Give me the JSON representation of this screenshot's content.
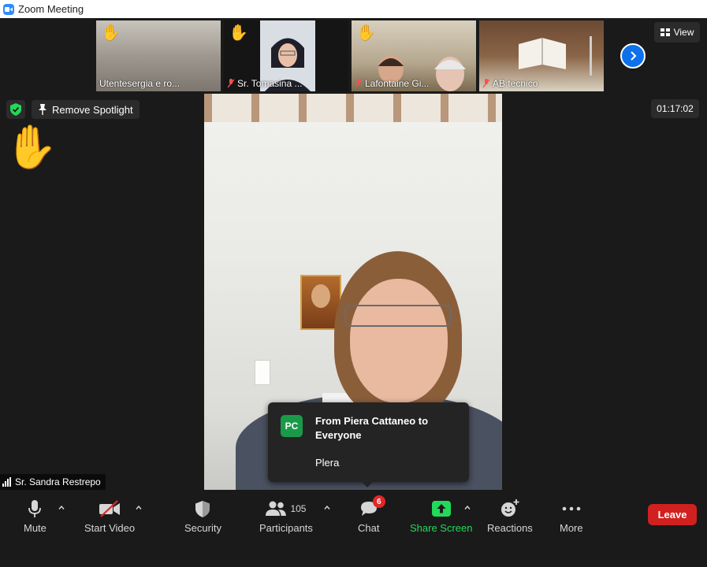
{
  "window": {
    "title": "Zoom Meeting"
  },
  "thumbnails": [
    {
      "name": "Utentesergia e ro..."
    },
    {
      "name": "Sr. Tomasina ..."
    },
    {
      "name": "Lafontaine Gi..."
    },
    {
      "name": "AB tecnico"
    }
  ],
  "view_button": {
    "label": "View"
  },
  "spotlight": {
    "remove_label": "Remove Spotlight"
  },
  "meeting": {
    "timer": "01:17:02",
    "active_speaker": "Sr. Sandra Restrepo"
  },
  "chat_popup": {
    "avatar_initials": "PC",
    "from_line": "From Piera Cattaneo to Everyone",
    "message": "Plera"
  },
  "toolbar": {
    "mute_label": "Mute",
    "video_label": "Start Video",
    "security_label": "Security",
    "participants_label": "Participants",
    "participants_count": "105",
    "chat_label": "Chat",
    "chat_badge": "6",
    "share_label": "Share Screen",
    "reactions_label": "Reactions",
    "more_label": "More",
    "leave_label": "Leave"
  },
  "colors": {
    "background": "#1a1a1a",
    "share_green": "#23d959",
    "leave_red": "#d12020",
    "accent_blue": "#0e71eb",
    "chat_avatar_green": "#1a9a49"
  },
  "icons": {
    "raised_hand": "✋"
  }
}
